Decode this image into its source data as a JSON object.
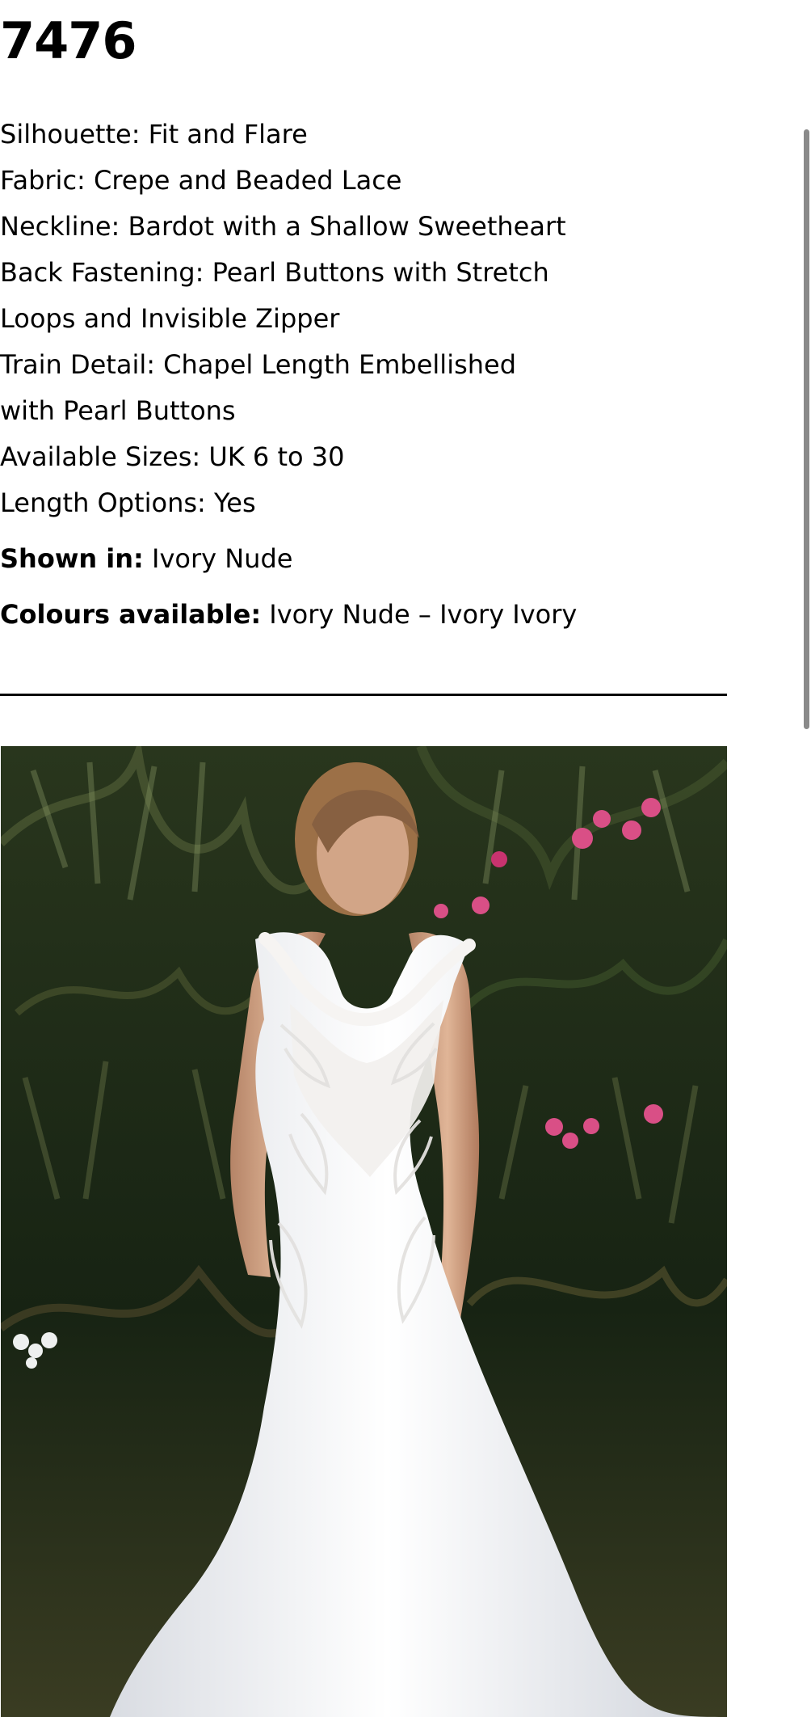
{
  "product": {
    "title": "7476",
    "specs": [
      "Silhouette: Fit and Flare",
      "Fabric: Crepe and Beaded Lace",
      "Neckline: Bardot with a Shallow Sweetheart",
      "Back Fastening: Pearl Buttons with Stretch",
      "Loops and Invisible Zipper",
      "Train Detail: Chapel Length Embellished",
      "with Pearl Buttons",
      "Available Sizes: UK 6 to 30",
      "Length Options: Yes"
    ],
    "shown_in": {
      "label": "Shown in:",
      "value": "Ivory Nude"
    },
    "colours": {
      "label": "Colours available:",
      "value": "Ivory Nude – Ivory Ivory"
    }
  },
  "image": {
    "subject": "bride-in-wedding-dress",
    "dress_colour": "#f2f0ee",
    "foliage_colour": "#1f2d16",
    "flower_colour": "#d94f86"
  },
  "scrollbar": {
    "thumb_colour": "#8a8a8a"
  }
}
